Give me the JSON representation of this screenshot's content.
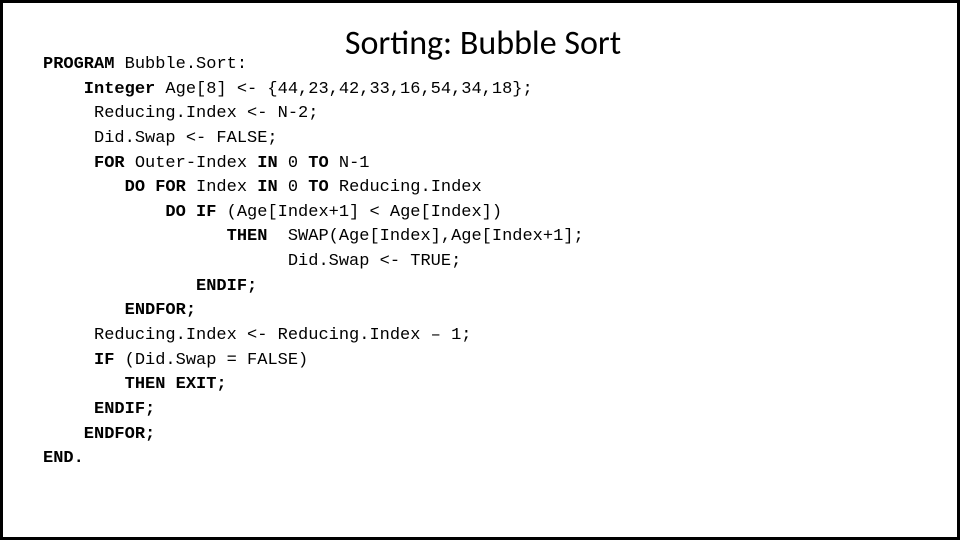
{
  "title": "Sorting: Bubble Sort",
  "code": {
    "l1a": "PROGRAM",
    "l1b": " Bubble.Sort:",
    "l2a": "    Integer",
    "l2b": " Age[8] <- {44,23,42,33,16,54,34,18};",
    "l3": "     Reducing.Index <- N-2;",
    "l4": "     Did.Swap <- FALSE;",
    "l5a": "     FOR",
    "l5b": " Outer-Index ",
    "l5c": "IN",
    "l5d": " 0 ",
    "l5e": "TO",
    "l5f": " N-1",
    "l6a": "        DO FOR",
    "l6b": " Index ",
    "l6c": "IN",
    "l6d": " 0 ",
    "l6e": "TO",
    "l6f": " Reducing.Index",
    "l7a": "            DO IF",
    "l7b": " (Age[Index+1] < Age[Index])",
    "l8a": "                  THEN",
    "l8b": "  SWAP(Age[Index],Age[Index+1];",
    "l9": "                        Did.Swap <- TRUE;",
    "l10a": "               ENDIF;",
    "l11a": "        ENDFOR;",
    "l12": "     Reducing.Index <- Reducing.Index – 1;",
    "l13a": "     IF",
    "l13b": " (Did.Swap = FALSE)",
    "l14a": "        THEN EXIT;",
    "l15a": "     ENDIF;",
    "l16a": "    ENDFOR;",
    "l17a": "END."
  }
}
